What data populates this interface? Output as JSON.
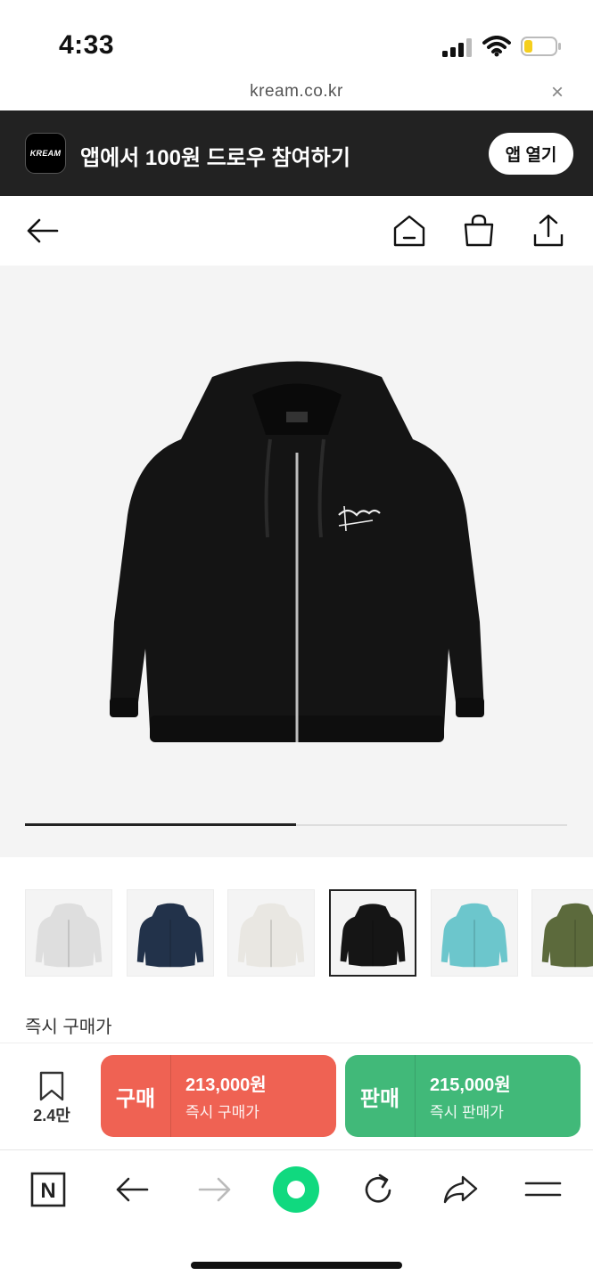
{
  "status_bar": {
    "time": "4:33"
  },
  "url_bar": {
    "url": "kream.co.kr",
    "close_glyph": "×"
  },
  "app_banner": {
    "logo_text": "KREAM",
    "message": "앱에서 100원 드로우 참여하기",
    "open_label": "앱 열기"
  },
  "nav": {
    "icons": [
      "back-arrow-icon",
      "home-icon",
      "shopping-bag-icon",
      "share-icon"
    ]
  },
  "product": {
    "image_progress": 0.5,
    "thumbnails": [
      {
        "color": "#dedede",
        "name": "ash-heather"
      },
      {
        "color": "#22324a",
        "name": "navy"
      },
      {
        "color": "#e9e7e2",
        "name": "natural"
      },
      {
        "color": "#151515",
        "name": "black"
      },
      {
        "color": "#6cc6cc",
        "name": "aqua"
      },
      {
        "color": "#5c6a3c",
        "name": "olive"
      }
    ],
    "selected_thumbnail": 3
  },
  "section": {
    "label": "즉시 구매가"
  },
  "action_bar": {
    "bookmark_count": "2.4만",
    "buy": {
      "tag": "구매",
      "price": "213,000원",
      "sub": "즉시 구매가",
      "color": "#ef6253"
    },
    "sell": {
      "tag": "판매",
      "price": "215,000원",
      "sub": "즉시 판매가",
      "color": "#41b979"
    }
  },
  "browser_toolbar": {
    "icons": [
      "naver-n-icon",
      "back-icon",
      "forward-icon",
      "green-dot-icon",
      "reload-icon",
      "share-arrow-icon",
      "menu-icon"
    ],
    "n_label": "N"
  }
}
